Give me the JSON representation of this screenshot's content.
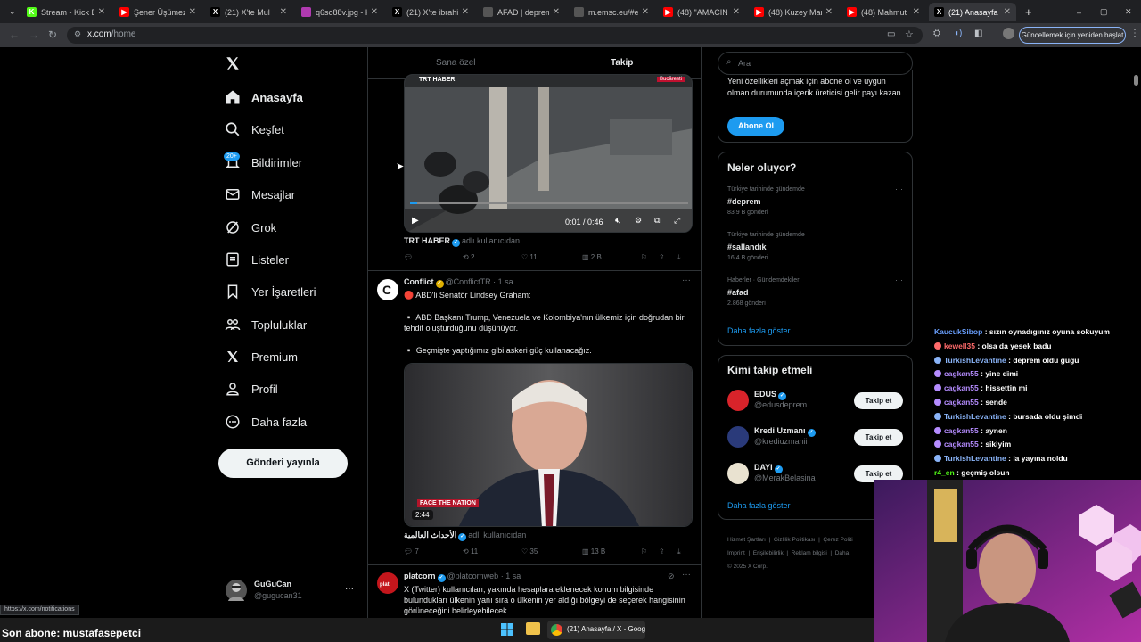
{
  "browser": {
    "tabs": [
      {
        "title": "Stream - Kick Da",
        "color": "#53fc18",
        "glyph": "K"
      },
      {
        "title": "Şener Üşümezso",
        "color": "#ff0000",
        "glyph": "▶"
      },
      {
        "title": "(21) X'te Mul",
        "color": "#000000",
        "glyph": "X"
      },
      {
        "title": "q6so88v.jpg - Hi",
        "color": "#b03ab0",
        "glyph": ""
      },
      {
        "title": "(21) X'te ibrahim",
        "color": "#000000",
        "glyph": "X"
      },
      {
        "title": "AFAD | deprem.a",
        "color": "#555555",
        "glyph": ""
      },
      {
        "title": "m.emsc.eu/#eart",
        "color": "#555555",
        "glyph": ""
      },
      {
        "title": "(48) \"AMACIN N",
        "color": "#ff0000",
        "glyph": "▶"
      },
      {
        "title": "(48) Kuzey Marm",
        "color": "#ff0000",
        "glyph": "▶"
      },
      {
        "title": "(48) Mahmut Usl",
        "color": "#ff0000",
        "glyph": "▶"
      },
      {
        "title": "(21) Anasayfa / X",
        "color": "#000000",
        "glyph": "X"
      }
    ],
    "url_host": "x.com",
    "url_path": "/home",
    "update_button": "Güncellemek için yeniden başlat",
    "status_url": "https://x.com/notifications"
  },
  "nav": {
    "items": [
      {
        "label": "Anasayfa",
        "icon": "home-icon"
      },
      {
        "label": "Keşfet",
        "icon": "search-icon"
      },
      {
        "label": "Bildirimler",
        "icon": "bell-icon"
      },
      {
        "label": "Mesajlar",
        "icon": "mail-icon"
      },
      {
        "label": "Grok",
        "icon": "grok-icon"
      },
      {
        "label": "Listeler",
        "icon": "list-icon"
      },
      {
        "label": "Yer İşaretleri",
        "icon": "bookmark-icon"
      },
      {
        "label": "Topluluklar",
        "icon": "communities-icon"
      },
      {
        "label": "Premium",
        "icon": "x-icon"
      },
      {
        "label": "Profil",
        "icon": "profile-icon"
      },
      {
        "label": "Daha fazla",
        "icon": "more-icon"
      }
    ],
    "notif_badge": "20+",
    "post_button": "Gönderi yayınla",
    "user_name": "GuGuCan",
    "user_handle": "@gugucan31"
  },
  "feed": {
    "tab_for_you": "Sana özel",
    "tab_following": "Takip",
    "tweet1": {
      "video_source": "TRT HABER",
      "video_time": "0:01 / 0:46",
      "video_location": "Bucăresti",
      "source_name": "TRT HABER",
      "source_suffix": "adlı kullanıcıdan",
      "retweets": "2",
      "likes": "11",
      "views": "2 B"
    },
    "tweet2": {
      "name": "Conflict",
      "handle": "@ConflictTR",
      "time": "· 1 sa",
      "line1": "🔴 ABD'li Senatör Lindsey Graham:",
      "line2": "▫️ ABD Başkanı Trump, Venezuela ve Kolombiya'nın ülkemiz için doğrudan bir tehdit oluşturduğunu düşünüyor.",
      "line3": "▫️ Geçmişte yaptığımız gibi askeri güç kullanacağız.",
      "video_duration": "2:44",
      "video_logo": "FACE THE NATION",
      "source_name": "الأحداث العالمية",
      "source_suffix": "adlı kullanıcıdan",
      "replies": "7",
      "retweets": "11",
      "likes": "35",
      "views": "13 B"
    },
    "tweet3": {
      "name": "platcorn",
      "handle": "@platcornweb",
      "time": "· 1 sa",
      "text": "X (Twitter) kullanıcıları, yakında hesaplara eklenecek konum bilgisinde bulundukları ülkenin yanı sıra o ülkenin yer aldığı bölgeyi de seçerek hangisinin görüneceğini belirleyebilecek."
    }
  },
  "right": {
    "search_placeholder": "Ara",
    "premium_text": "Yeni özellikleri açmak için abone ol ve uygun olman durumunda içerik üreticisi gelir payı kazan.",
    "premium_button": "Abone Ol",
    "trends_title": "Neler oluyor?",
    "trends": [
      {
        "context": "Türkiye tarihinde gündemde",
        "tag": "#deprem",
        "count": "83,9 B gönderi"
      },
      {
        "context": "Türkiye tarihinde gündemde",
        "tag": "#sallandık",
        "count": "16,4 B gönderi"
      },
      {
        "context": "Haberler · Gündemdekiler",
        "tag": "#afad",
        "count": "2.868 gönderi"
      }
    ],
    "show_more": "Daha fazla göster",
    "wtf_title": "Kimi takip etmeli",
    "follow_button": "Takip et",
    "suggestions": [
      {
        "name": "EDUS",
        "handle": "@edusdeprem"
      },
      {
        "name": "Kredi Uzmanı",
        "handle": "@krediuzmanii"
      },
      {
        "name": "DAYI",
        "handle": "@MerakBelasina"
      }
    ],
    "footer": [
      "Hizmet Şartları",
      "Gizlilik Politikası",
      "Çerez Politi",
      "Imprint",
      "Erişilebilirlik",
      "Reklam bilgisi",
      "Daha",
      "© 2025 X Corp."
    ]
  },
  "chat": [
    {
      "user": "KaucukSibop",
      "msg": ": sızın oynadıgınız oyuna sokuyum",
      "color": "#6aa0ff"
    },
    {
      "user": "kewell35",
      "msg": ": olsa da yesek badu",
      "color": "#ff6a6a"
    },
    {
      "user": "TurkishLevantine",
      "msg": ": deprem oldu gugu",
      "color": "#8ab4f8"
    },
    {
      "user": "cagkan55",
      "msg": ": yine dimi",
      "color": "#b58cff"
    },
    {
      "user": "cagkan55",
      "msg": ": hissettin mi",
      "color": "#b58cff"
    },
    {
      "user": "cagkan55",
      "msg": ": sende",
      "color": "#b58cff"
    },
    {
      "user": "TurkishLevantine",
      "msg": ": bursada oldu şimdi",
      "color": "#8ab4f8"
    },
    {
      "user": "cagkan55",
      "msg": ": aynen",
      "color": "#b58cff"
    },
    {
      "user": "cagkan55",
      "msg": ": sikiyim",
      "color": "#b58cff"
    },
    {
      "user": "TurkishLevantine",
      "msg": ": la yayına noldu",
      "color": "#8ab4f8"
    },
    {
      "user": "r4_en",
      "msg": ": geçmiş olsun",
      "color": "#53fc18"
    }
  ],
  "stream": {
    "last_sub": "Son abone: mustafasepetci",
    "taskbar_app": "(21) Anasayfa / X - Goog"
  },
  "colors": {
    "accent": "#1d9bf0",
    "bg": "#000000",
    "border": "#2f3336"
  }
}
